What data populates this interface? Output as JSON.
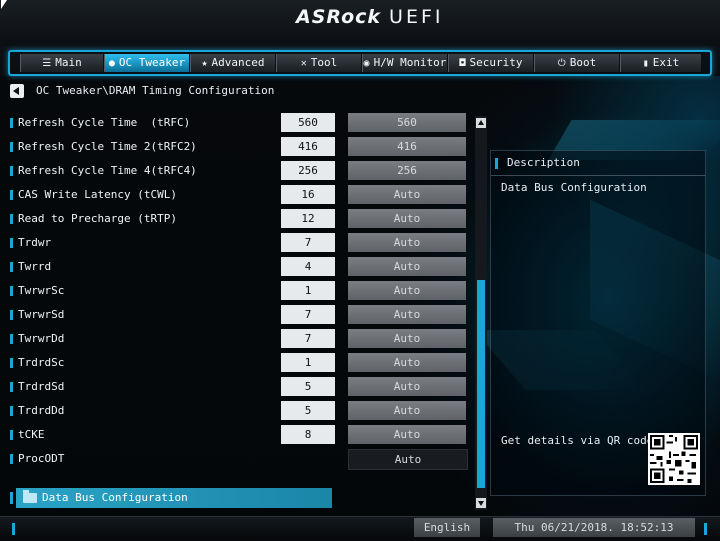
{
  "brand": {
    "logo": "ASRock",
    "product": "UEFI"
  },
  "tabs": [
    {
      "icon": "list-icon",
      "glyph": "☰",
      "label": "Main"
    },
    {
      "icon": "flame-icon",
      "glyph": "●",
      "label": "OC Tweaker"
    },
    {
      "icon": "star-icon",
      "glyph": "★",
      "label": "Advanced"
    },
    {
      "icon": "wrench-icon",
      "glyph": "✕",
      "label": "Tool"
    },
    {
      "icon": "monitor-icon",
      "glyph": "◉",
      "label": "H/W Monitor"
    },
    {
      "icon": "shield-icon",
      "glyph": "◘",
      "label": "Security"
    },
    {
      "icon": "power-icon",
      "glyph": "⏻",
      "label": "Boot"
    },
    {
      "icon": "exit-icon",
      "glyph": "▮",
      "label": "Exit"
    }
  ],
  "active_tab": "OC Tweaker",
  "breadcrumb": "OC Tweaker\\DRAM Timing Configuration",
  "settings": [
    {
      "label": "Refresh Cycle Time  (tRFC)",
      "current": "560",
      "setting": "560"
    },
    {
      "label": "Refresh Cycle Time 2(tRFC2)",
      "current": "416",
      "setting": "416"
    },
    {
      "label": "Refresh Cycle Time 4(tRFC4)",
      "current": "256",
      "setting": "256"
    },
    {
      "label": "CAS Write Latency (tCWL)",
      "current": "16",
      "setting": "Auto"
    },
    {
      "label": "Read to Precharge (tRTP)",
      "current": "12",
      "setting": "Auto"
    },
    {
      "label": "Trdwr",
      "current": "7",
      "setting": "Auto"
    },
    {
      "label": "Twrrd",
      "current": "4",
      "setting": "Auto"
    },
    {
      "label": "TwrwrSc",
      "current": "1",
      "setting": "Auto"
    },
    {
      "label": "TwrwrSd",
      "current": "7",
      "setting": "Auto"
    },
    {
      "label": "TwrwrDd",
      "current": "7",
      "setting": "Auto"
    },
    {
      "label": "TrdrdSc",
      "current": "1",
      "setting": "Auto"
    },
    {
      "label": "TrdrdSd",
      "current": "5",
      "setting": "Auto"
    },
    {
      "label": "TrdrdDd",
      "current": "5",
      "setting": "Auto"
    },
    {
      "label": "tCKE",
      "current": "8",
      "setting": "Auto"
    },
    {
      "label": "ProcODT",
      "current": "",
      "setting": "Auto"
    }
  ],
  "selected_item": "Data Bus Configuration",
  "description": {
    "title": "Description",
    "text": "Data Bus Configuration",
    "qr_text": "Get details via QR code"
  },
  "footer": {
    "language": "English",
    "datetime": "Thu 06/21/2018. 18:52:13"
  },
  "colors": {
    "accent": "#1aa6d6",
    "active_tab": "#2ec0ee"
  }
}
